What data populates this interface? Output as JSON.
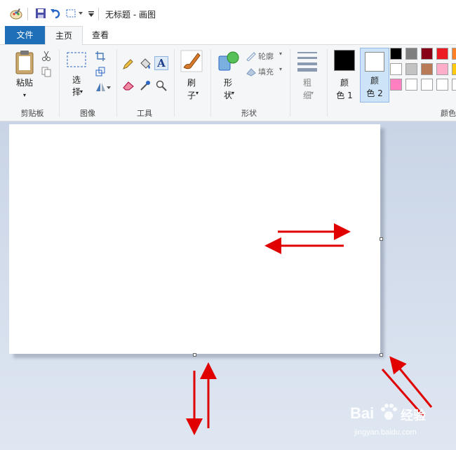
{
  "window": {
    "title": "无标题 - 画图"
  },
  "tabs": [
    {
      "label": "文件"
    },
    {
      "label": "主页"
    },
    {
      "label": "查看"
    }
  ],
  "ribbon": {
    "clipboard": {
      "paste_label_1": "粘贴",
      "group_label": "剪贴板"
    },
    "image": {
      "select_label_1": "选",
      "select_label_2": "择",
      "group_label": "图像"
    },
    "tools": {
      "text_tool": "A",
      "group_label": "工具"
    },
    "brushes": {
      "label_1": "刷",
      "label_2": "子"
    },
    "shapes": {
      "label_1": "形",
      "label_2": "状",
      "outline_label": "轮廓",
      "fill_label": "填充",
      "group_label": "形状"
    },
    "size": {
      "label_1": "粗",
      "label_2": "细"
    },
    "colors": {
      "color1_label_1": "颜",
      "color1_label_2": "色 1",
      "color2_label_1": "颜",
      "color2_label_2": "色 2",
      "group_label_partial": "颜色",
      "color1_value": "#000000",
      "color2_value": "#ffffff",
      "palette_row1": [
        "#000000",
        "#7f7f7f",
        "#880015",
        "#ed1c24",
        "#ff7f27"
      ],
      "palette_row2": [
        "#ffffff",
        "#c3c3c3",
        "#b97a57",
        "#ffaec9",
        "#ffc90e"
      ],
      "palette_row3": [
        "#ff80c0",
        "#ffffff",
        "#ffffff",
        "#ffffff",
        "#ffffff"
      ]
    }
  },
  "annotation_color": "#e00000",
  "watermark": {
    "brand": "Bai",
    "brand2": "经验",
    "url": "jingyan.baidu.com"
  }
}
